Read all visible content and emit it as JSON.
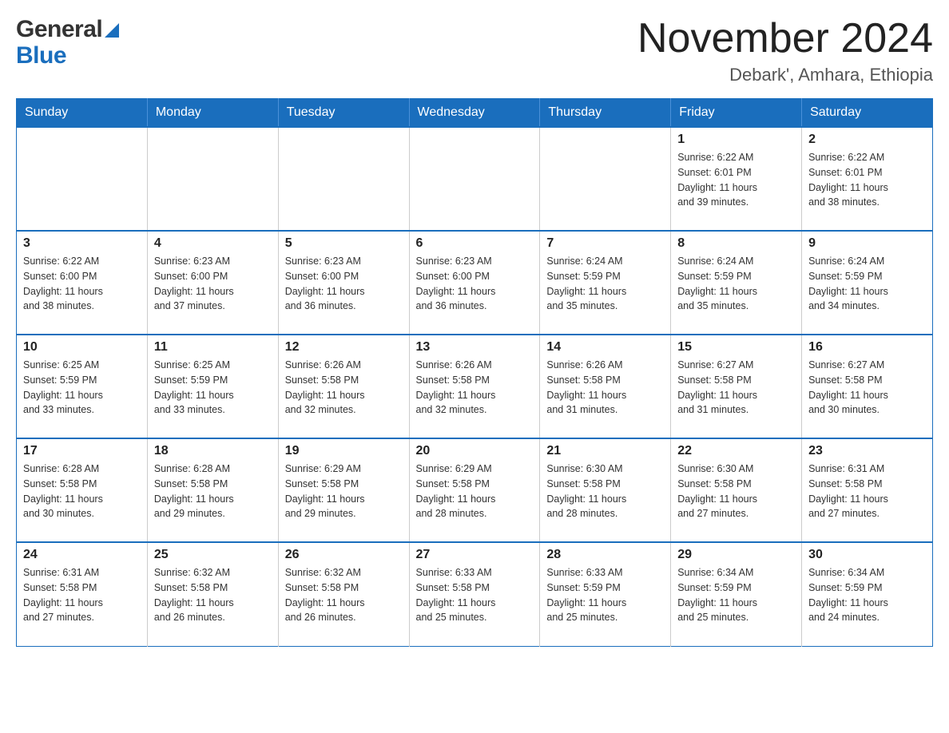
{
  "header": {
    "logo_line1": "General",
    "logo_line2": "Blue",
    "month_title": "November 2024",
    "location": "Debark', Amhara, Ethiopia"
  },
  "weekdays": [
    "Sunday",
    "Monday",
    "Tuesday",
    "Wednesday",
    "Thursday",
    "Friday",
    "Saturday"
  ],
  "weeks": [
    [
      {
        "day": "",
        "info": ""
      },
      {
        "day": "",
        "info": ""
      },
      {
        "day": "",
        "info": ""
      },
      {
        "day": "",
        "info": ""
      },
      {
        "day": "",
        "info": ""
      },
      {
        "day": "1",
        "info": "Sunrise: 6:22 AM\nSunset: 6:01 PM\nDaylight: 11 hours\nand 39 minutes."
      },
      {
        "day": "2",
        "info": "Sunrise: 6:22 AM\nSunset: 6:01 PM\nDaylight: 11 hours\nand 38 minutes."
      }
    ],
    [
      {
        "day": "3",
        "info": "Sunrise: 6:22 AM\nSunset: 6:00 PM\nDaylight: 11 hours\nand 38 minutes."
      },
      {
        "day": "4",
        "info": "Sunrise: 6:23 AM\nSunset: 6:00 PM\nDaylight: 11 hours\nand 37 minutes."
      },
      {
        "day": "5",
        "info": "Sunrise: 6:23 AM\nSunset: 6:00 PM\nDaylight: 11 hours\nand 36 minutes."
      },
      {
        "day": "6",
        "info": "Sunrise: 6:23 AM\nSunset: 6:00 PM\nDaylight: 11 hours\nand 36 minutes."
      },
      {
        "day": "7",
        "info": "Sunrise: 6:24 AM\nSunset: 5:59 PM\nDaylight: 11 hours\nand 35 minutes."
      },
      {
        "day": "8",
        "info": "Sunrise: 6:24 AM\nSunset: 5:59 PM\nDaylight: 11 hours\nand 35 minutes."
      },
      {
        "day": "9",
        "info": "Sunrise: 6:24 AM\nSunset: 5:59 PM\nDaylight: 11 hours\nand 34 minutes."
      }
    ],
    [
      {
        "day": "10",
        "info": "Sunrise: 6:25 AM\nSunset: 5:59 PM\nDaylight: 11 hours\nand 33 minutes."
      },
      {
        "day": "11",
        "info": "Sunrise: 6:25 AM\nSunset: 5:59 PM\nDaylight: 11 hours\nand 33 minutes."
      },
      {
        "day": "12",
        "info": "Sunrise: 6:26 AM\nSunset: 5:58 PM\nDaylight: 11 hours\nand 32 minutes."
      },
      {
        "day": "13",
        "info": "Sunrise: 6:26 AM\nSunset: 5:58 PM\nDaylight: 11 hours\nand 32 minutes."
      },
      {
        "day": "14",
        "info": "Sunrise: 6:26 AM\nSunset: 5:58 PM\nDaylight: 11 hours\nand 31 minutes."
      },
      {
        "day": "15",
        "info": "Sunrise: 6:27 AM\nSunset: 5:58 PM\nDaylight: 11 hours\nand 31 minutes."
      },
      {
        "day": "16",
        "info": "Sunrise: 6:27 AM\nSunset: 5:58 PM\nDaylight: 11 hours\nand 30 minutes."
      }
    ],
    [
      {
        "day": "17",
        "info": "Sunrise: 6:28 AM\nSunset: 5:58 PM\nDaylight: 11 hours\nand 30 minutes."
      },
      {
        "day": "18",
        "info": "Sunrise: 6:28 AM\nSunset: 5:58 PM\nDaylight: 11 hours\nand 29 minutes."
      },
      {
        "day": "19",
        "info": "Sunrise: 6:29 AM\nSunset: 5:58 PM\nDaylight: 11 hours\nand 29 minutes."
      },
      {
        "day": "20",
        "info": "Sunrise: 6:29 AM\nSunset: 5:58 PM\nDaylight: 11 hours\nand 28 minutes."
      },
      {
        "day": "21",
        "info": "Sunrise: 6:30 AM\nSunset: 5:58 PM\nDaylight: 11 hours\nand 28 minutes."
      },
      {
        "day": "22",
        "info": "Sunrise: 6:30 AM\nSunset: 5:58 PM\nDaylight: 11 hours\nand 27 minutes."
      },
      {
        "day": "23",
        "info": "Sunrise: 6:31 AM\nSunset: 5:58 PM\nDaylight: 11 hours\nand 27 minutes."
      }
    ],
    [
      {
        "day": "24",
        "info": "Sunrise: 6:31 AM\nSunset: 5:58 PM\nDaylight: 11 hours\nand 27 minutes."
      },
      {
        "day": "25",
        "info": "Sunrise: 6:32 AM\nSunset: 5:58 PM\nDaylight: 11 hours\nand 26 minutes."
      },
      {
        "day": "26",
        "info": "Sunrise: 6:32 AM\nSunset: 5:58 PM\nDaylight: 11 hours\nand 26 minutes."
      },
      {
        "day": "27",
        "info": "Sunrise: 6:33 AM\nSunset: 5:58 PM\nDaylight: 11 hours\nand 25 minutes."
      },
      {
        "day": "28",
        "info": "Sunrise: 6:33 AM\nSunset: 5:59 PM\nDaylight: 11 hours\nand 25 minutes."
      },
      {
        "day": "29",
        "info": "Sunrise: 6:34 AM\nSunset: 5:59 PM\nDaylight: 11 hours\nand 25 minutes."
      },
      {
        "day": "30",
        "info": "Sunrise: 6:34 AM\nSunset: 5:59 PM\nDaylight: 11 hours\nand 24 minutes."
      }
    ]
  ]
}
